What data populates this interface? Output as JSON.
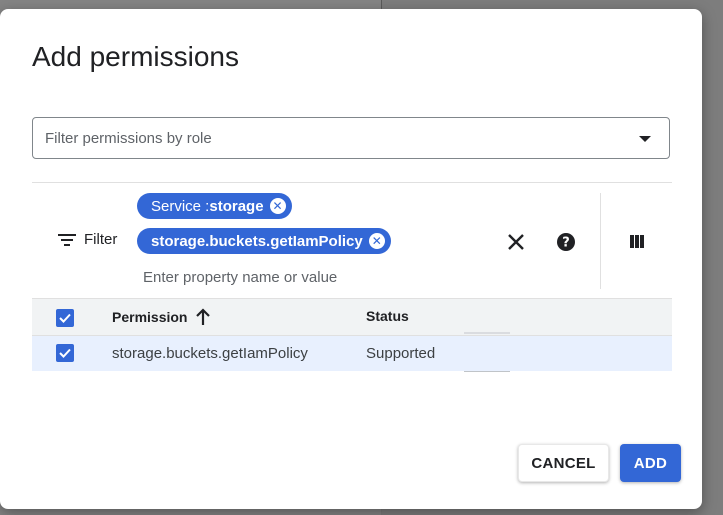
{
  "dialog": {
    "title": "Add permissions",
    "role_filter": {
      "placeholder": "Filter permissions by role"
    },
    "filter_bar": {
      "label": "Filter",
      "chips": [
        {
          "key": "Service : ",
          "value": "storage"
        },
        {
          "key": "",
          "value": "storage.buckets.getIamPolicy"
        }
      ],
      "input_placeholder": "Enter property name or value"
    },
    "table": {
      "columns": [
        "Permission",
        "Status"
      ],
      "rows": [
        {
          "permission": "storage.buckets.getIamPolicy",
          "status": "Supported",
          "checked": true
        }
      ]
    },
    "buttons": {
      "cancel": "CANCEL",
      "add": "ADD"
    }
  },
  "colors": {
    "accent": "#3367d6"
  },
  "icons": [
    "filter-icon",
    "chip-remove-icon",
    "close-icon",
    "help-icon",
    "columns-icon",
    "arrow-up-icon",
    "check-icon",
    "dropdown-caret-icon"
  ]
}
